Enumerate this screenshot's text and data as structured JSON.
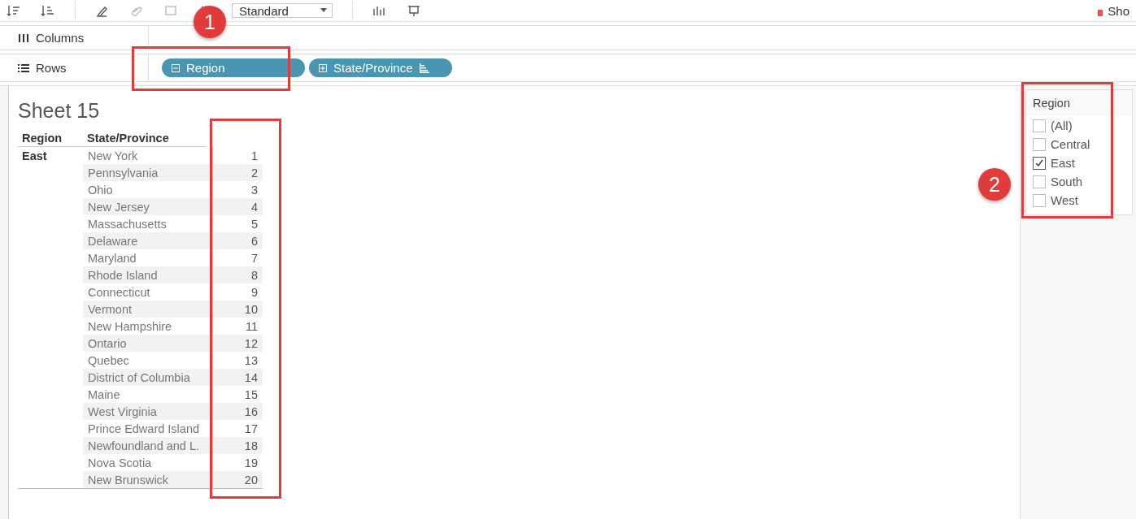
{
  "toolbar": {
    "view_mode": "Standard",
    "show_me": "Sho"
  },
  "shelves": [
    {
      "label": "Columns",
      "kind": "columns"
    },
    {
      "label": "Rows",
      "kind": "rows",
      "pills": [
        {
          "label": "Region",
          "expanded": true,
          "sorted": false
        },
        {
          "label": "State/Province",
          "expanded": false,
          "sorted": true
        }
      ]
    }
  ],
  "sheet": {
    "title": "Sheet 15",
    "columns": [
      "Region",
      "State/Province"
    ],
    "region": "East",
    "rows": [
      {
        "state": "New York",
        "rank": "1"
      },
      {
        "state": "Pennsylvania",
        "rank": "2"
      },
      {
        "state": "Ohio",
        "rank": "3"
      },
      {
        "state": "New Jersey",
        "rank": "4"
      },
      {
        "state": "Massachusetts",
        "rank": "5"
      },
      {
        "state": "Delaware",
        "rank": "6"
      },
      {
        "state": "Maryland",
        "rank": "7"
      },
      {
        "state": "Rhode Island",
        "rank": "8"
      },
      {
        "state": "Connecticut",
        "rank": "9"
      },
      {
        "state": "Vermont",
        "rank": "10"
      },
      {
        "state": "New Hampshire",
        "rank": "11"
      },
      {
        "state": "Ontario",
        "rank": "12"
      },
      {
        "state": "Quebec",
        "rank": "13"
      },
      {
        "state": "District of Columbia",
        "rank": "14"
      },
      {
        "state": "Maine",
        "rank": "15"
      },
      {
        "state": "West Virginia",
        "rank": "16"
      },
      {
        "state": "Prince Edward Island",
        "rank": "17"
      },
      {
        "state": "Newfoundland and L.",
        "rank": "18"
      },
      {
        "state": "Nova Scotia",
        "rank": "19"
      },
      {
        "state": "New Brunswick",
        "rank": "20"
      }
    ]
  },
  "filter": {
    "title": "Region",
    "items": [
      {
        "label": "(All)",
        "checked": false
      },
      {
        "label": "Central",
        "checked": false
      },
      {
        "label": "East",
        "checked": true
      },
      {
        "label": "South",
        "checked": false
      },
      {
        "label": "West",
        "checked": false
      }
    ]
  },
  "annotations": [
    {
      "number": "1"
    },
    {
      "number": "2"
    }
  ]
}
